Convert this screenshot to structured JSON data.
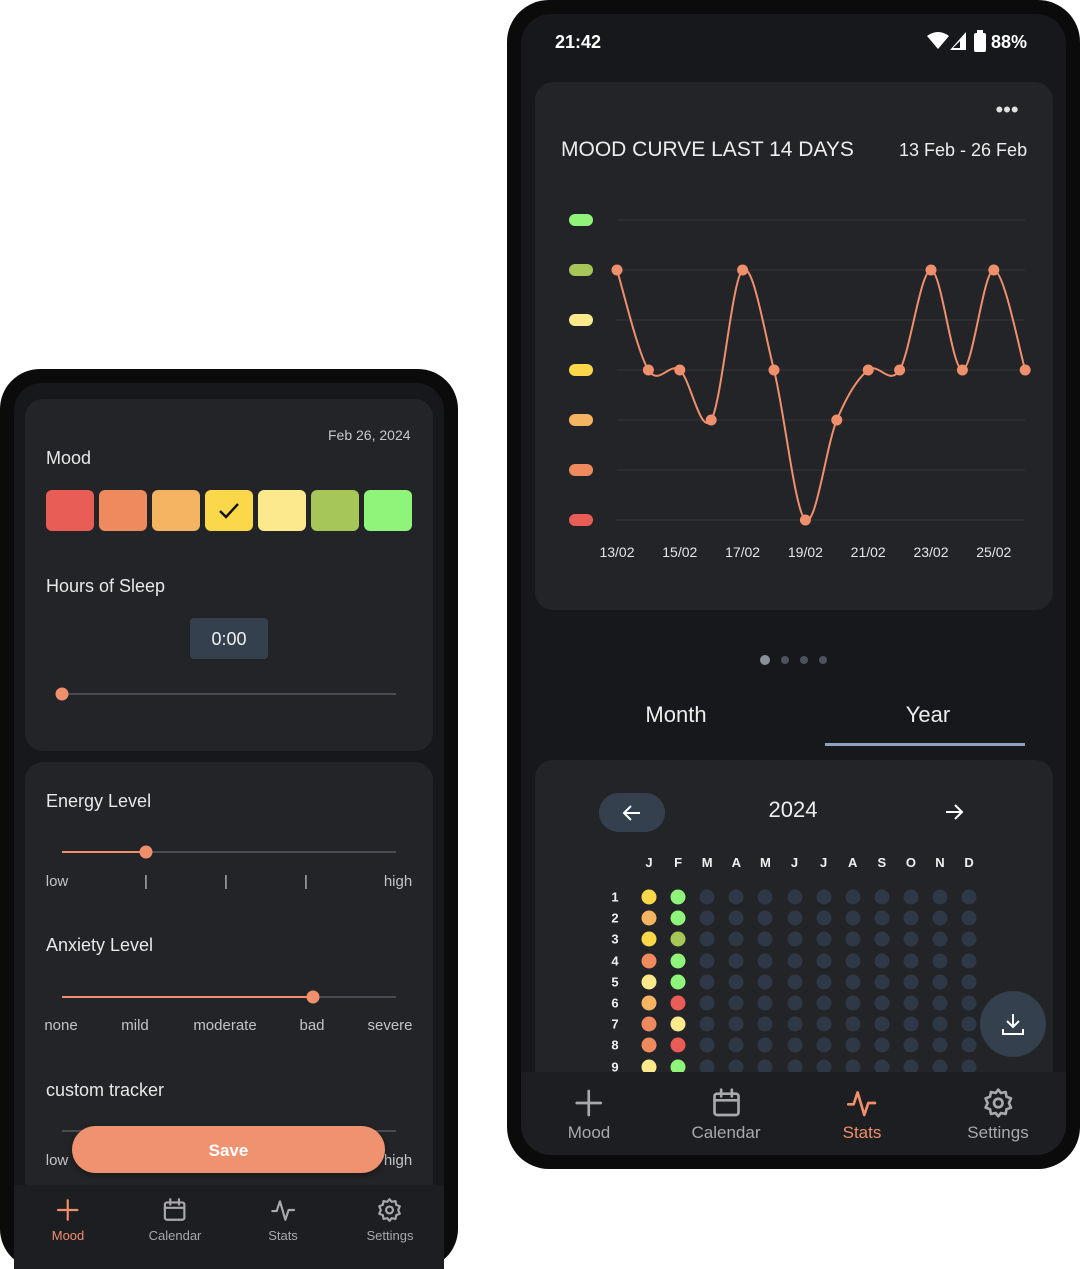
{
  "colors": {
    "accent": "#ef8f6c",
    "mood_scale": [
      "#e85d55",
      "#ef8a5e",
      "#f4b462",
      "#fad84a",
      "#fbe98b",
      "#a6c658",
      "#8ef57a"
    ],
    "empty_dot": "#2e3846"
  },
  "left": {
    "date": "Feb 26, 2024",
    "mood_label": "Mood",
    "mood_selected_index": 3,
    "sleep_label": "Hours of Sleep",
    "sleep_value": "0:00",
    "sleep_level": 0,
    "energy_label": "Energy Level",
    "energy_level": 0.25,
    "energy_ticks": [
      "low",
      "|",
      "|",
      "|",
      "high"
    ],
    "anxiety_label": "Anxiety Level",
    "anxiety_level": 0.75,
    "anxiety_ticks": [
      "none",
      "mild",
      "moderate",
      "bad",
      "severe"
    ],
    "custom_label": "custom tracker",
    "custom_ticks": [
      "low",
      "high"
    ],
    "save_label": "Save",
    "nav": [
      {
        "label": "Mood",
        "icon": "plus-icon",
        "active": true
      },
      {
        "label": "Calendar",
        "icon": "calendar-icon",
        "active": false
      },
      {
        "label": "Stats",
        "icon": "pulse-icon",
        "active": false
      },
      {
        "label": "Settings",
        "icon": "gear-icon",
        "active": false
      }
    ]
  },
  "right": {
    "status": {
      "time": "21:42",
      "battery": "88%"
    },
    "chart_title": "MOOD CURVE LAST 14 DAYS",
    "chart_range": "13 Feb - 26 Feb",
    "tabs": [
      "Month",
      "Year"
    ],
    "active_tab": 1,
    "year": "2024",
    "month_letters": [
      "J",
      "F",
      "M",
      "A",
      "M",
      "J",
      "J",
      "A",
      "S",
      "O",
      "N",
      "D"
    ],
    "day_numbers": [
      "1",
      "2",
      "3",
      "4",
      "5",
      "6",
      "7",
      "8",
      "9"
    ],
    "year_grid": {
      "jan": [
        3,
        2,
        3,
        1,
        4,
        2,
        1,
        1,
        4
      ],
      "feb": [
        6,
        6,
        5,
        6,
        6,
        0,
        4,
        0,
        6
      ]
    },
    "nav": [
      {
        "label": "Mood",
        "icon": "plus-icon",
        "active": false
      },
      {
        "label": "Calendar",
        "icon": "calendar-icon",
        "active": false
      },
      {
        "label": "Stats",
        "icon": "pulse-icon",
        "active": true
      },
      {
        "label": "Settings",
        "icon": "gear-icon",
        "active": false
      }
    ]
  },
  "chart_data": {
    "type": "line",
    "title": "MOOD CURVE LAST 14 DAYS",
    "subtitle": "13 Feb - 26 Feb",
    "x": [
      "13/02",
      "14/02",
      "15/02",
      "16/02",
      "17/02",
      "18/02",
      "19/02",
      "20/02",
      "21/02",
      "22/02",
      "23/02",
      "24/02",
      "25/02",
      "26/02"
    ],
    "x_tick_labels": [
      "13/02",
      "15/02",
      "17/02",
      "19/02",
      "21/02",
      "23/02",
      "25/02"
    ],
    "series": [
      {
        "values": [
          5,
          3,
          3,
          2,
          5,
          3,
          0,
          2,
          3,
          3,
          5,
          3,
          5,
          3
        ]
      }
    ],
    "y_scale": "mood levels 0 (worst) to 6 (best), shown as colored markers",
    "ylim": [
      0,
      6
    ],
    "grid": true
  }
}
